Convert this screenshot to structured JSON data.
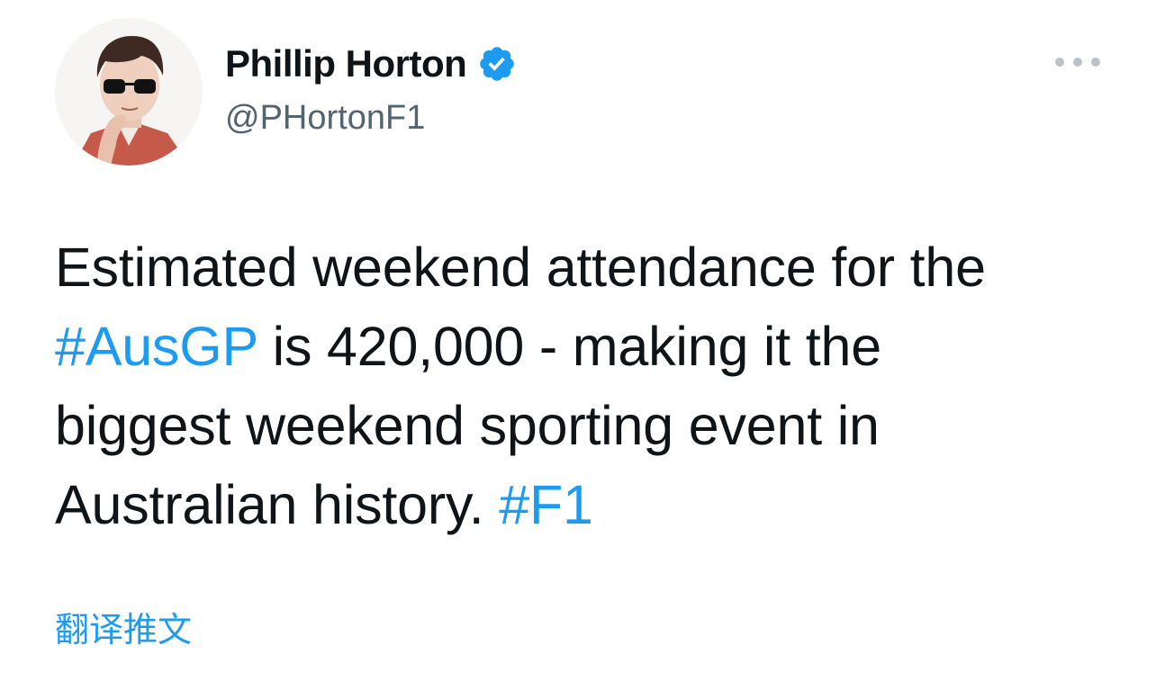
{
  "author": {
    "display_name": "Phillip Horton",
    "handle": "@PHortonF1",
    "verified": true,
    "avatar_icon": "profile-photo"
  },
  "tweet": {
    "line1": "Estimated weekend attendance for the",
    "line2_hashtag": "#AusGP",
    "line2_text": " is 420,000 - making it the",
    "line3": "biggest weekend sporting event in",
    "line4_text": "Australian history. ",
    "line4_hashtag": "#F1"
  },
  "actions": {
    "more_icon": "more-horizontal-icon",
    "translate_label": "翻译推文"
  },
  "colors": {
    "text": "#0f1419",
    "secondary": "#536471",
    "accent": "#1d9bf0",
    "more_dots": "#bcc3c8"
  }
}
